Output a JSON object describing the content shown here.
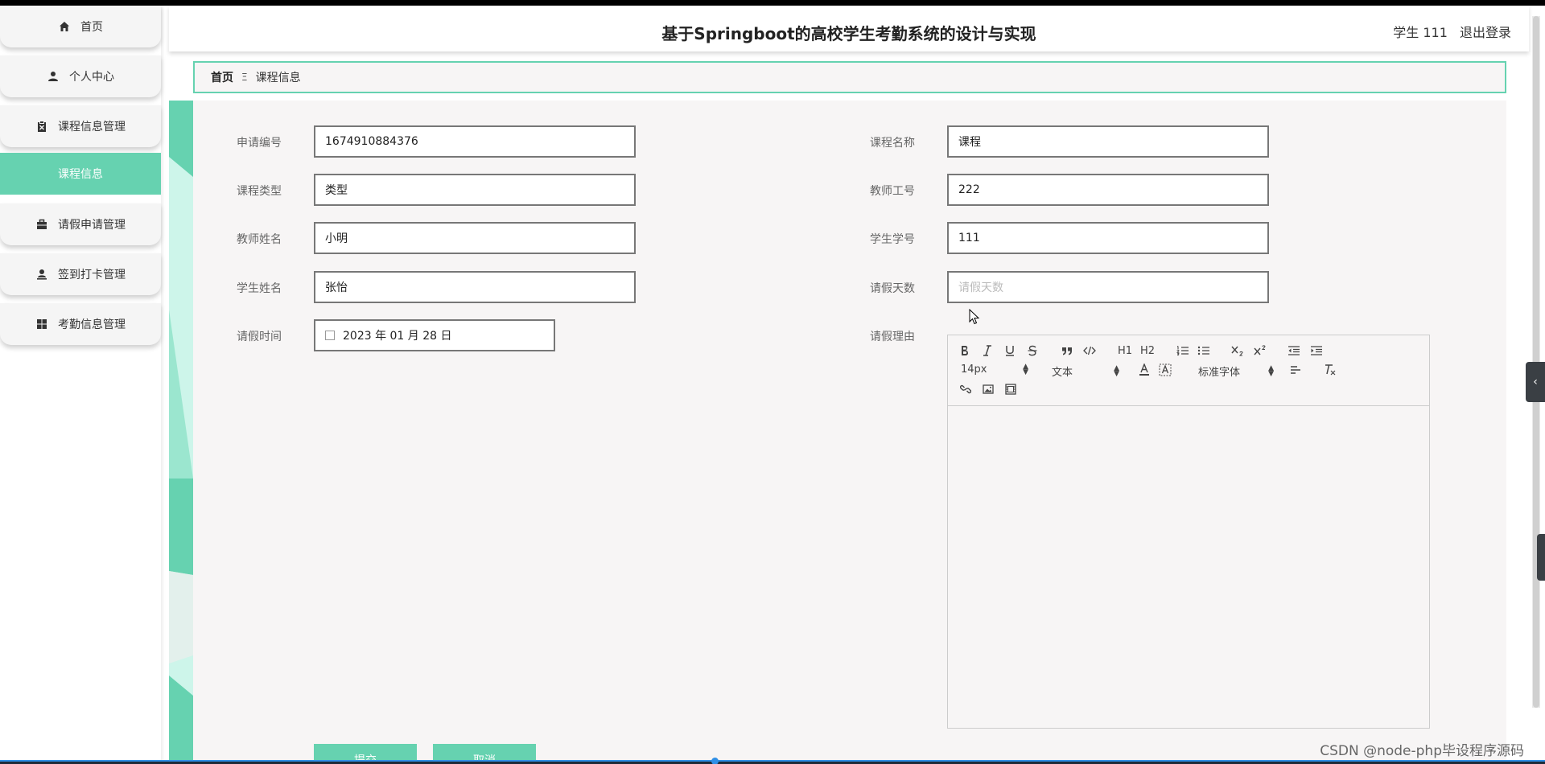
{
  "header": {
    "title": "基于Springboot的高校学生考勤系统的设计与实现",
    "user": "学生 111",
    "logout": "退出登录"
  },
  "sidebar": {
    "items": [
      {
        "label": "首页",
        "icon": "home-icon"
      },
      {
        "label": "个人中心",
        "icon": "user-icon"
      },
      {
        "label": "课程信息管理",
        "icon": "clipboard-icon"
      },
      {
        "label": "课程信息",
        "active": true
      },
      {
        "label": "请假申请管理",
        "icon": "briefcase-icon"
      },
      {
        "label": "签到打卡管理",
        "icon": "person-stamp-icon"
      },
      {
        "label": "考勤信息管理",
        "icon": "grid-icon"
      }
    ]
  },
  "breadcrumb": {
    "home": "首页",
    "separator": "Ξ",
    "current": "课程信息"
  },
  "form": {
    "left": [
      {
        "label": "申请编号",
        "value": "1674910884376"
      },
      {
        "label": "课程类型",
        "value": "类型"
      },
      {
        "label": "教师姓名",
        "value": "小明"
      },
      {
        "label": "学生姓名",
        "value": "张怡"
      }
    ],
    "right": [
      {
        "label": "课程名称",
        "value": "课程"
      },
      {
        "label": "教师工号",
        "value": "222"
      },
      {
        "label": "学生学号",
        "value": "111"
      },
      {
        "label": "请假天数",
        "value": "",
        "placeholder": "请假天数"
      }
    ],
    "date": {
      "label": "请假时间",
      "value": "2023 年 01 月 28 日"
    },
    "reason": {
      "label": "请假理由"
    }
  },
  "editor": {
    "font_size": "14px",
    "block_type": "文本",
    "font_family": "标准字体",
    "header1": "H1",
    "header2": "H2"
  },
  "buttons": {
    "submit": "提交",
    "cancel": "取消"
  },
  "watermark": "CSDN @node-php毕设程序源码",
  "colors": {
    "accent": "#66d2b0",
    "panel_bg": "#f7f5f5"
  }
}
